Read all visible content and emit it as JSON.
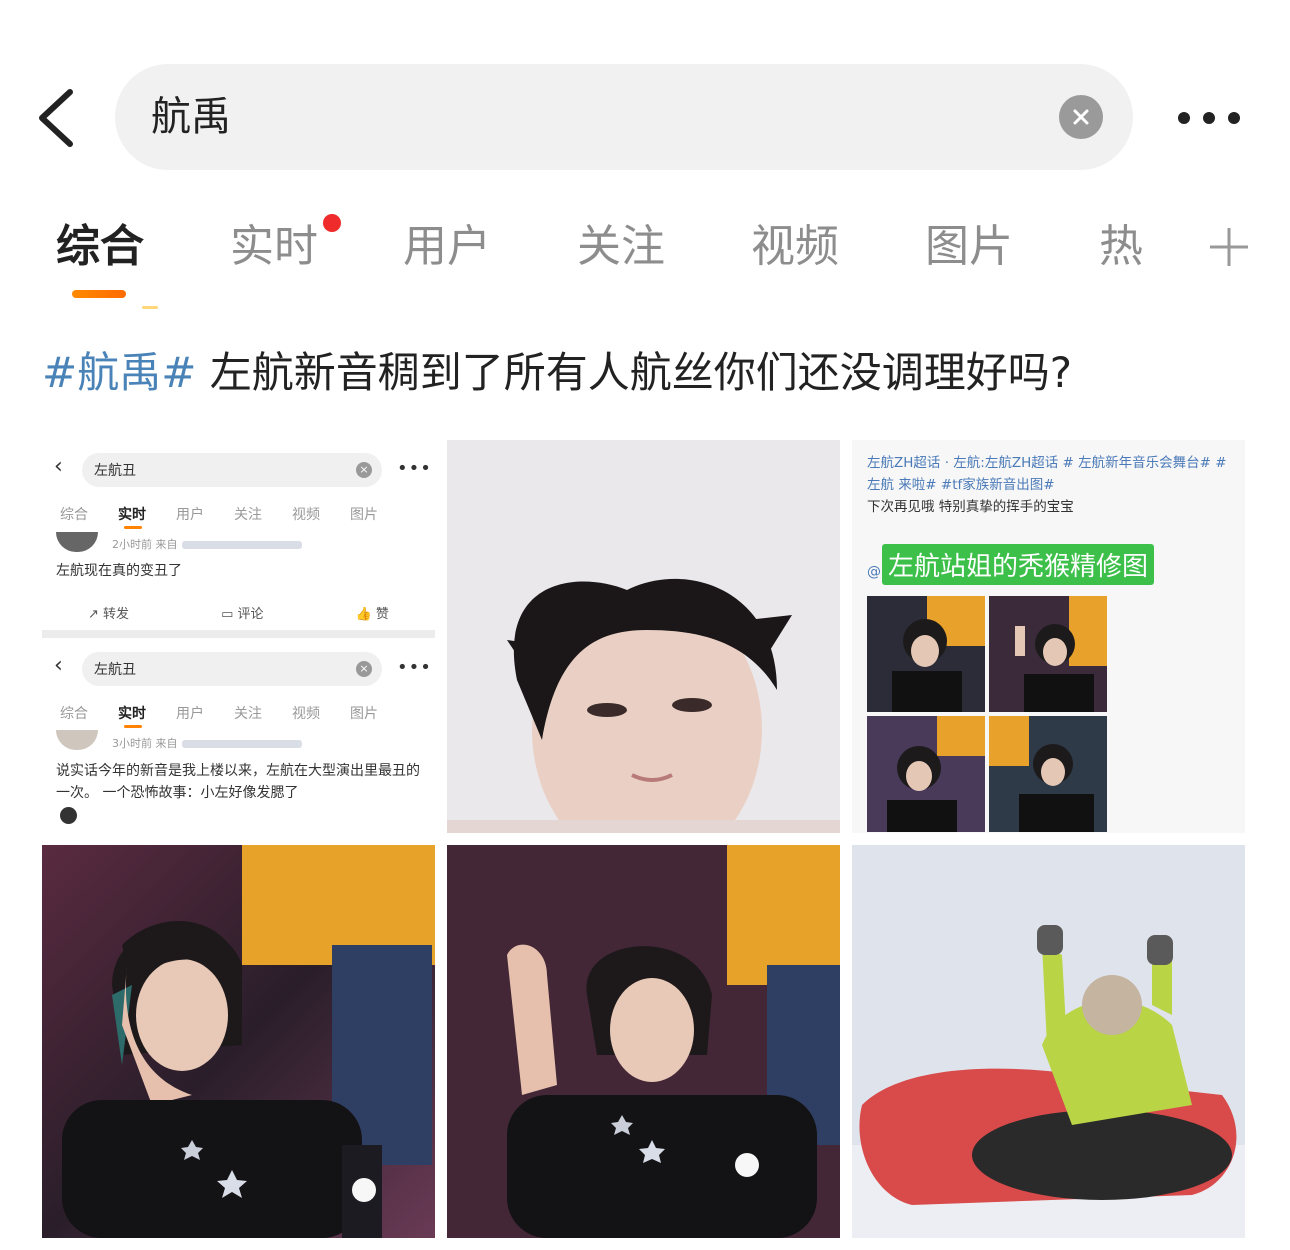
{
  "search": {
    "query": "航禹"
  },
  "tabs": [
    {
      "label": "综合",
      "active": true
    },
    {
      "label": "实时",
      "active": false,
      "has_dot": true
    },
    {
      "label": "用户",
      "active": false
    },
    {
      "label": "关注",
      "active": false
    },
    {
      "label": "视频",
      "active": false
    },
    {
      "label": "图片",
      "active": false
    },
    {
      "label": "热",
      "active": false
    }
  ],
  "post": {
    "hashtag": "#航禹#",
    "text": " 左航新音稠到了所有人航丝你们还没调理好吗?"
  },
  "image1": {
    "panel1": {
      "query": "左航丑",
      "tabs": [
        "综合",
        "实时",
        "用户",
        "关注",
        "视频",
        "图片"
      ],
      "meta": "2小时前  来自",
      "text": "左航现在真的变丑了",
      "actions": {
        "repost": "转发",
        "comment": "评论",
        "like": "赞"
      }
    },
    "panel2": {
      "query": "左航丑",
      "tabs": [
        "综合",
        "实时",
        "用户",
        "关注",
        "视频",
        "图片"
      ],
      "meta": "3小时前  来自",
      "text": "说实话今年的新音是我上楼以来，左航在大型演出里最丑的一次。 一个恐怖故事：小左好像发腮了"
    }
  },
  "image3": {
    "line1": "左航ZH超话 ·          左航:左航ZH超话 # 左航新年音乐会舞台# #左航 来啦# #tf家族新音出图#",
    "line2": "下次再见哦 特别真挚的挥手的宝宝",
    "highlight": "左航站姐的秃猴精修图",
    "at": "@"
  },
  "colors": {
    "accent_orange": "#ff8200",
    "hashtag_blue": "#4a83b7",
    "live_dot": "#f02b2b",
    "highlight_green": "#3cc04a"
  },
  "icons": {
    "back": "chevron-left-icon",
    "clear": "clear-x-icon",
    "more": "more-dots-icon",
    "add_tab": "plus-icon"
  }
}
